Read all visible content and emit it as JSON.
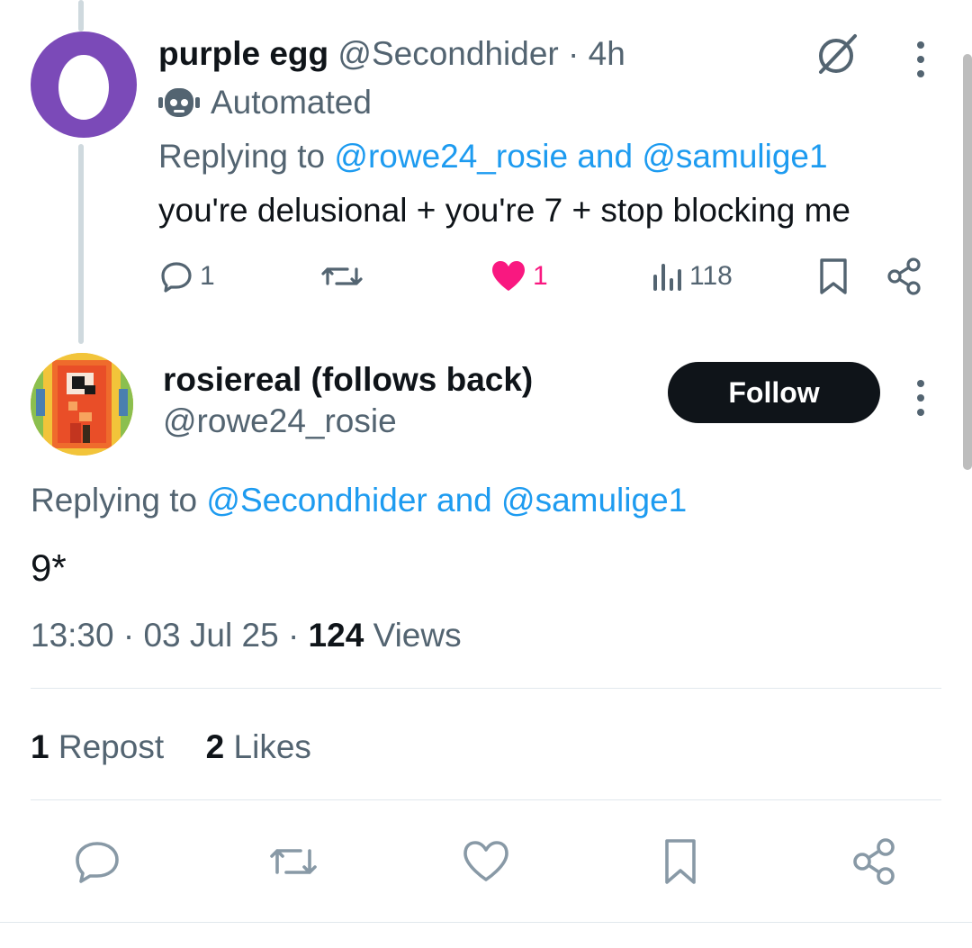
{
  "tweet1": {
    "display_name": "purple egg",
    "handle": "@Secondhider",
    "separator": "·",
    "time": "4h",
    "automated_label": "Automated",
    "replying_prefix": "Replying to",
    "reply_user1": "@rowe24_rosie",
    "reply_and": "and",
    "reply_user2": "@samulige1",
    "body": "you're delusional + you're 7 + stop blocking me",
    "stats": {
      "replies": "1",
      "likes": "1",
      "views": "118"
    }
  },
  "tweet2": {
    "display_name": "rosiereal (follows back)",
    "handle": "@rowe24_rosie",
    "follow_label": "Follow",
    "replying_prefix": "Replying to",
    "reply_user1": "@Secondhider",
    "reply_and": "and",
    "reply_user2": "@samulige1",
    "body": "9*",
    "time": "13:30",
    "sep1": "·",
    "date": "03 Jul 25",
    "sep2": "·",
    "views_count": "124",
    "views_label": "Views",
    "reposts_count": "1",
    "reposts_label": "Repost",
    "likes_count": "2",
    "likes_label": "Likes"
  },
  "colors": {
    "accent": "#1d9bf0",
    "like": "#f91880",
    "muted": "#536471",
    "text": "#0f1419"
  },
  "icons": {
    "grok": "grok-icon",
    "more": "more-icon",
    "bot": "bot-icon",
    "reply": "reply-icon",
    "repost": "repost-icon",
    "like": "heart-filled-icon",
    "views": "views-icon",
    "bookmark": "bookmark-icon",
    "share": "share-icon"
  }
}
